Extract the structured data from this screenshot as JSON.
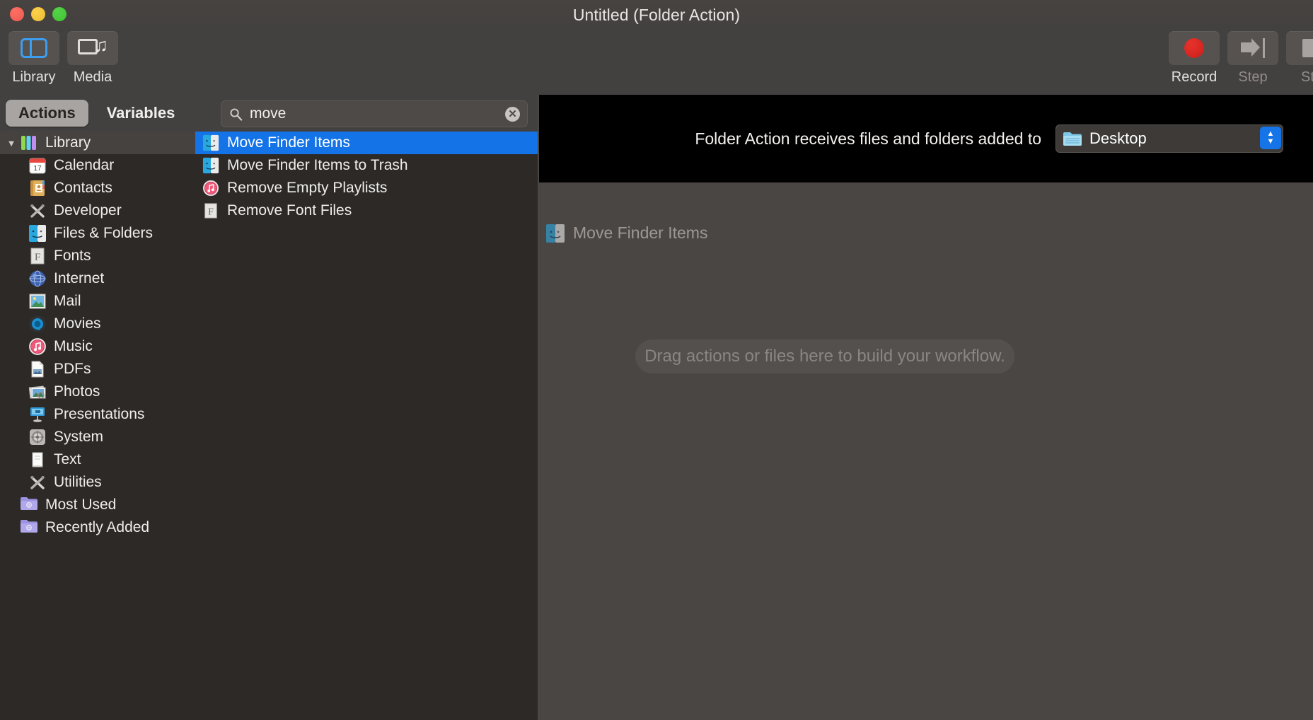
{
  "window": {
    "title": "Untitled (Folder Action)",
    "traffic_lights": [
      "close",
      "minimize",
      "maximize"
    ]
  },
  "toolbar": {
    "left_items": [
      {
        "label": "Library",
        "icon": "sidebar-icon",
        "active": true
      },
      {
        "label": "Media",
        "icon": "media-icon",
        "active": false
      }
    ],
    "right_items": [
      {
        "label": "Record",
        "icon": "record-icon",
        "enabled": true
      },
      {
        "label": "Step",
        "icon": "step-icon",
        "enabled": false
      },
      {
        "label": "Sto",
        "icon": "stop-icon",
        "enabled": false
      }
    ]
  },
  "left_pane": {
    "tabs": [
      {
        "label": "Actions",
        "selected": true
      },
      {
        "label": "Variables",
        "selected": false
      }
    ],
    "search": {
      "value": "move",
      "placeholder": "Search",
      "icon": "search-icon",
      "clear_glyph": "✕"
    },
    "tree": {
      "root": {
        "label": "Library",
        "icon": "automator-library-icon",
        "expanded": true,
        "disclosure": "▼"
      },
      "children": [
        {
          "label": "Calendar",
          "icon": "calendar-icon"
        },
        {
          "label": "Contacts",
          "icon": "contacts-icon"
        },
        {
          "label": "Developer",
          "icon": "developer-icon"
        },
        {
          "label": "Files & Folders",
          "icon": "finder-icon"
        },
        {
          "label": "Fonts",
          "icon": "fontbook-icon"
        },
        {
          "label": "Internet",
          "icon": "globe-icon"
        },
        {
          "label": "Mail",
          "icon": "mail-icon"
        },
        {
          "label": "Movies",
          "icon": "quicktime-icon"
        },
        {
          "label": "Music",
          "icon": "itunes-icon"
        },
        {
          "label": "PDFs",
          "icon": "pdf-icon"
        },
        {
          "label": "Photos",
          "icon": "photos-icon"
        },
        {
          "label": "Presentations",
          "icon": "keynote-icon"
        },
        {
          "label": "System",
          "icon": "system-prefs-icon"
        },
        {
          "label": "Text",
          "icon": "textedit-icon"
        },
        {
          "label": "Utilities",
          "icon": "developer-icon"
        }
      ],
      "smart_folders": [
        {
          "label": "Most Used",
          "icon": "smart-folder-icon"
        },
        {
          "label": "Recently Added",
          "icon": "smart-folder-icon"
        }
      ]
    },
    "results": [
      {
        "label": "Move Finder Items",
        "icon": "finder-icon",
        "selected": true
      },
      {
        "label": "Move Finder Items to Trash",
        "icon": "finder-icon",
        "selected": false
      },
      {
        "label": "Remove Empty Playlists",
        "icon": "itunes-icon",
        "selected": false
      },
      {
        "label": "Remove Font Files",
        "icon": "fontbook-icon",
        "selected": false
      }
    ]
  },
  "workflow": {
    "header_text": "Folder Action receives files and folders added to",
    "folder_popup": {
      "value": "Desktop",
      "icon": "folder-icon",
      "stepper_up": "▲",
      "stepper_down": "▼"
    },
    "drag_ghost": {
      "label": "Move Finder Items",
      "icon": "finder-icon"
    },
    "dropzone_text": "Drag actions or files here to build your workflow."
  },
  "colors": {
    "selection_blue": "#1473e6",
    "accent_blue": "#3c9ef0",
    "record_red": "#c91f1a",
    "window_chrome": "#434040",
    "list_background": "#2c2927",
    "canvas": "#4a4644",
    "header_black": "#000000"
  }
}
